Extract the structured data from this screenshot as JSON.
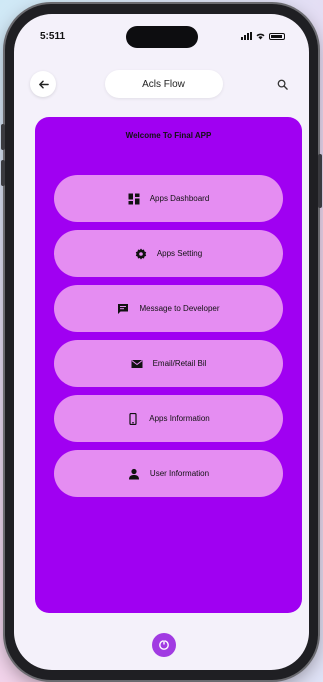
{
  "status_bar": {
    "time": "5:511"
  },
  "app_bar": {
    "title": "Acls Flow"
  },
  "panel": {
    "welcome": "Welcome To Final APP",
    "menu": [
      {
        "label": "Apps Dashboard",
        "icon": "dashboard-icon"
      },
      {
        "label": "Apps Setting",
        "icon": "gear-icon"
      },
      {
        "label": "Message to Developer",
        "icon": "chat-icon"
      },
      {
        "label": "Email/Retail Bil",
        "icon": "mail-icon"
      },
      {
        "label": "Apps Information",
        "icon": "phone-icon"
      },
      {
        "label": "User Information",
        "icon": "person-icon"
      }
    ]
  },
  "colors": {
    "panel": "#a000f2",
    "menu_item": "#e58df2",
    "home_button": "#a13be2"
  }
}
